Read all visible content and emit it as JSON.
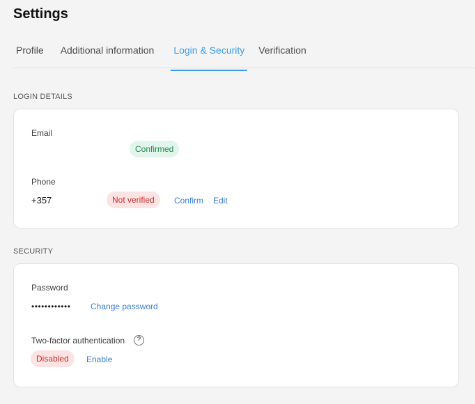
{
  "header": {
    "title": "Settings"
  },
  "tabs": [
    {
      "label": "Profile"
    },
    {
      "label": "Additional information"
    },
    {
      "label": "Login & Security"
    },
    {
      "label": "Verification"
    }
  ],
  "login_details": {
    "section_title": "LOGIN DETAILS",
    "email": {
      "label": "Email",
      "value": "",
      "status": "Confirmed"
    },
    "phone": {
      "label": "Phone",
      "value": "+357",
      "status": "Not verified",
      "confirm_label": "Confirm",
      "edit_label": "Edit"
    }
  },
  "security": {
    "section_title": "SECURITY",
    "password": {
      "label": "Password",
      "value": "••••••••••••",
      "change_label": "Change password"
    },
    "two_factor": {
      "label": "Two-factor authentication",
      "status": "Disabled",
      "enable_label": "Enable",
      "help_icon": "?"
    }
  },
  "colors": {
    "accent": "#3d9be9",
    "link": "#3a7fd1",
    "success_bg": "#e2f5ec",
    "success_text": "#1f8a4c",
    "danger_bg": "#fde4e4",
    "danger_text": "#c9302c"
  }
}
